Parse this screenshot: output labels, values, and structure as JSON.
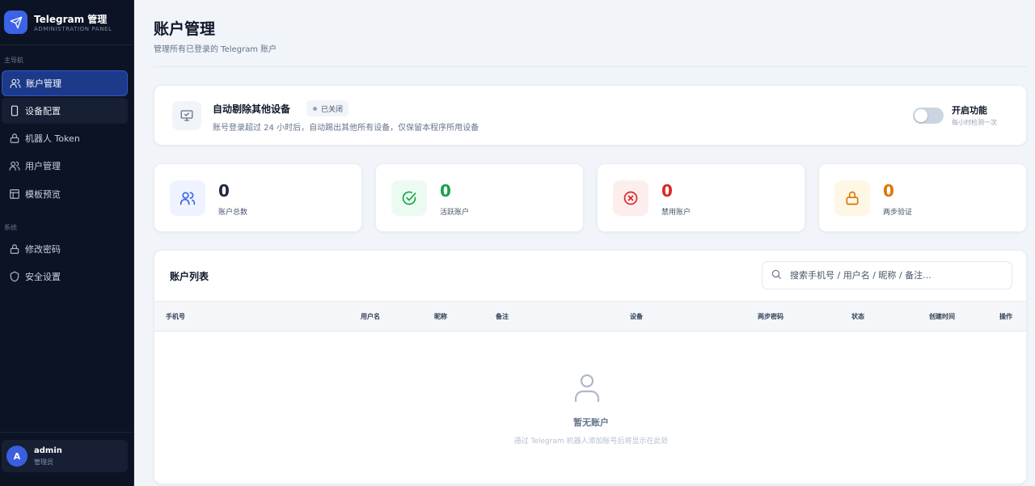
{
  "brand": {
    "title": "Telegram 管理",
    "subtitle": "ADMINISTRATION PANEL"
  },
  "sidebar": {
    "main_section": "主导航",
    "main_items": [
      {
        "label": "账户管理",
        "icon": "users-icon",
        "state": "active"
      },
      {
        "label": "设备配置",
        "icon": "device-icon",
        "state": "hover"
      },
      {
        "label": "机器人 Token",
        "icon": "lock-icon",
        "state": "normal"
      },
      {
        "label": "用户管理",
        "icon": "users-icon",
        "state": "normal"
      },
      {
        "label": "模板预览",
        "icon": "layout-icon",
        "state": "normal"
      }
    ],
    "system_section": "系统",
    "system_items": [
      {
        "label": "修改密码",
        "icon": "lock-icon"
      },
      {
        "label": "安全设置",
        "icon": "shield-icon"
      }
    ],
    "user": {
      "avatar_letter": "A",
      "name": "admin",
      "role": "管理员"
    }
  },
  "header": {
    "title": "账户管理",
    "subtitle": "管理所有已登录的 Telegram 账户"
  },
  "auto_remove": {
    "title": "自动剔除其他设备",
    "badge": "已关闭",
    "description": "账号登录超过 24 小时后，自动踢出其他所有设备，仅保留本程序所用设备",
    "toggle_label": "开启功能",
    "toggle_sub": "每小时检测一次",
    "enabled": false
  },
  "stats": [
    {
      "value": "0",
      "label": "账户总数",
      "icon": "users-icon",
      "color": "#1e293b",
      "icon_color": "#3b63e6",
      "bg": "#eef3ff"
    },
    {
      "value": "0",
      "label": "活跃账户",
      "icon": "check-circle-icon",
      "color": "#16a34a",
      "icon_color": "#16a34a",
      "bg": "#ecfbf1"
    },
    {
      "value": "0",
      "label": "禁用账户",
      "icon": "x-circle-icon",
      "color": "#dc2626",
      "icon_color": "#dc2626",
      "bg": "#fdeeee"
    },
    {
      "value": "0",
      "label": "两步验证",
      "icon": "lock-icon",
      "color": "#d97706",
      "icon_color": "#d97706",
      "bg": "#fff7e6"
    }
  ],
  "account_list": {
    "title": "账户列表",
    "search_placeholder": "搜索手机号 / 用户名 / 昵称 / 备注...",
    "columns": [
      "手机号",
      "用户名",
      "昵称",
      "备注",
      "设备",
      "两步密码",
      "状态",
      "创建时间",
      "操作"
    ],
    "empty_title": "暂无账户",
    "empty_subtitle": "通过 Telegram 机器人添加账号后将显示在此处"
  }
}
